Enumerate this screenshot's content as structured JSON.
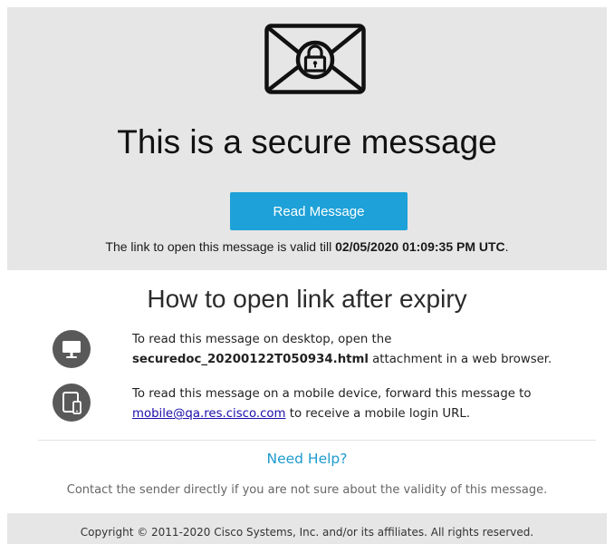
{
  "hero": {
    "title": "This is a secure message",
    "read_button_label": "Read Message",
    "validity_prefix": "The link to open this message is valid till ",
    "validity_datetime": "02/05/2020 01:09:35 PM UTC",
    "validity_suffix": "."
  },
  "howto": {
    "title": "How to open link after expiry",
    "desktop": {
      "line1": "To read this message on desktop, open the",
      "attachment_name": "securedoc_20200122T050934.html",
      "line2_suffix": " attachment in a web browser."
    },
    "mobile": {
      "line1": "To read this message on a mobile device, forward this message to",
      "email": "mobile@qa.res.cisco.com",
      "line2_suffix": " to receive a mobile login URL."
    }
  },
  "help": {
    "link_label": "Need Help?",
    "contact_text": "Contact the sender directly if you are not sure about the validity of this message."
  },
  "footer": {
    "copyright": "Copyright © 2011-2020 Cisco Systems, Inc. and/or its affiliates. All rights reserved."
  },
  "icons": {
    "envelope": "envelope-lock-icon",
    "desktop": "desktop-monitor-icon",
    "mobile": "tablet-phone-icon"
  },
  "colors": {
    "hero_background": "#e6e6e6",
    "button": "#1ea1d8",
    "help_link": "#1e9bcf",
    "icon_circle": "#595959"
  }
}
